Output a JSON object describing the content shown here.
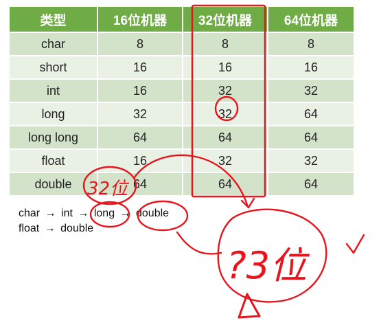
{
  "table": {
    "headers": [
      "类型",
      "16位机器",
      "32位机器",
      "64位机器"
    ],
    "rows": [
      {
        "type": "char",
        "v16": "8",
        "v32": "8",
        "v64": "8"
      },
      {
        "type": "short",
        "v16": "16",
        "v32": "16",
        "v64": "16"
      },
      {
        "type": "int",
        "v16": "16",
        "v32": "32",
        "v64": "32"
      },
      {
        "type": "long",
        "v16": "32",
        "v32": "32",
        "v64": "64"
      },
      {
        "type": "long long",
        "v16": "64",
        "v32": "64",
        "v64": "64"
      },
      {
        "type": "float",
        "v16": "16",
        "v32": "32",
        "v64": "32"
      },
      {
        "type": "double",
        "v16": "64",
        "v32": "64",
        "v64": "64"
      }
    ]
  },
  "notes": {
    "line1": {
      "a": "char",
      "arrow1": "→",
      "b": "int",
      "arrow2": "→",
      "c": "long",
      "arrow3": "→",
      "d": "double"
    },
    "line2": {
      "a": "float",
      "arrow1": "→",
      "b": "double"
    }
  },
  "handwriting": {
    "small_note": "32位",
    "big_note": "?3位"
  },
  "colors": {
    "header_green": "#6fac46",
    "row_dark": "#d3e3c9",
    "row_light": "#e9f0e4",
    "pen_red": "#e8141c"
  }
}
